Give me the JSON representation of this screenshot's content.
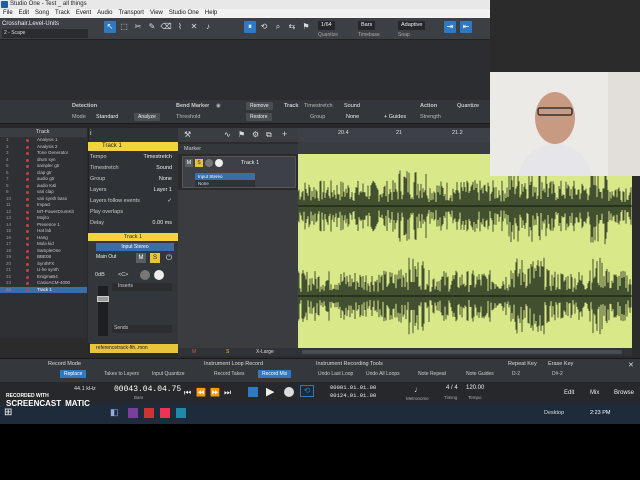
{
  "window": {
    "title": "Studio One - Test _ all things"
  },
  "menu": [
    "File",
    "Edit",
    "Song",
    "Track",
    "Event",
    "Audio",
    "Transport",
    "View",
    "Studio One",
    "Help"
  ],
  "toolbar": {
    "song_name": "Crosshair.Level-Units",
    "scene": "2 - Scape",
    "quantize_label": "Quantize",
    "quantize_value": "1/64",
    "timebase_label": "Timebase",
    "timebase_value": "Bars",
    "snap_label": "Snap",
    "snap_value": "Adaptive"
  },
  "detection": {
    "header": "Detection",
    "mode_label": "Mode",
    "mode_value": "Standard",
    "analyze": "Analyze",
    "bend_marker": "Bend Marker",
    "threshold": "Threshold",
    "remove": "Remove",
    "restore": "Restore",
    "track_header": "Track",
    "timestretch": "Timestretch",
    "sound": "Sound",
    "group": "Group",
    "none": "None",
    "guides": "+ Guides",
    "action_header": "Action",
    "quantize": "Quantize",
    "strength": "Strength"
  },
  "tracklist": {
    "header": "Track",
    "items": [
      {
        "num": "1",
        "name": "Analysis 1"
      },
      {
        "num": "2",
        "name": "Analysis 2"
      },
      {
        "num": "3",
        "name": "Tone Generator"
      },
      {
        "num": "4",
        "name": "drum syn"
      },
      {
        "num": "5",
        "name": "sampler gtr"
      },
      {
        "num": "6",
        "name": "clap gtr"
      },
      {
        "num": "7",
        "name": "audio gtr"
      },
      {
        "num": "8",
        "name": "audio K&l"
      },
      {
        "num": "9",
        "name": "vari clap"
      },
      {
        "num": "10",
        "name": "vari synth bass"
      },
      {
        "num": "11",
        "name": "Impact"
      },
      {
        "num": "12",
        "name": "MT-PowerDrumKit"
      },
      {
        "num": "13",
        "name": "Mojito"
      },
      {
        "num": "14",
        "name": "Presence 1"
      },
      {
        "num": "15",
        "name": "Hat lab"
      },
      {
        "num": "16",
        "name": "Hang"
      },
      {
        "num": "17",
        "name": "Mola kid"
      },
      {
        "num": "18",
        "name": "SampleOne"
      },
      {
        "num": "19",
        "name": "BBE08"
      },
      {
        "num": "20",
        "name": "SynthFX"
      },
      {
        "num": "21",
        "name": "U-he synth"
      },
      {
        "num": "22",
        "name": "EnigmaB4"
      },
      {
        "num": "23",
        "name": "CasioACM-4000"
      },
      {
        "num": "24",
        "name": "Track 1"
      }
    ],
    "selected_index": 23
  },
  "inspector": {
    "track_name": "Track 1",
    "tempo_label": "Tempo",
    "tempo_value": "Timestretch",
    "timestretch_label": "Timestretch",
    "timestretch_value": "Sound",
    "group_label": "Group",
    "group_value": "None",
    "layers_label": "Layers",
    "layers_value": "Layer 1",
    "layers_follow": "Layers follow events",
    "play_overlaps": "Play overlaps",
    "delay_label": "Delay",
    "delay_value": "0.00 ms",
    "channel_name": "Track 1",
    "input": "Input Stereo",
    "main_out": "Main Out",
    "gain": "0dB",
    "pan": "<C>",
    "inserts": "Inserts",
    "sends": "Sends",
    "reference_track": "referencetrack-fth..mon"
  },
  "arrange": {
    "marker_label": "Marker",
    "track_header_name": "Track 1",
    "input_label": "Input Stereo",
    "input_none": "None",
    "ruler_marks": [
      "20.4",
      "21",
      "21.2"
    ],
    "size_label": "X-Large",
    "mute_label": "M",
    "solo_label": "S"
  },
  "record_panel": {
    "record_mode": "Record Mode",
    "replace": "Replace",
    "takes_to_layers": "Takes to Layers",
    "input_quantize": "Input Quantize",
    "loop_record": "Instrument Loop Record",
    "record_takes": "Record Takes",
    "record_mix": "Record Mix",
    "tools_header": "Instrument Recording Tools",
    "undo_last_loop": "Undo Last Loop",
    "undo_all_loops": "Undo All Loops",
    "note_repeat": "Note Repeat",
    "note_guides": "Note Guides",
    "repeat_key": "Repeat Key",
    "repeat_key_value": "D-2",
    "erase_key": "Erase Key",
    "erase_key_value": "D#-2"
  },
  "transport": {
    "sample_rate": "44.1 kHz",
    "time": "00043.04.04.75",
    "time_unit": "Bars",
    "loop_start": "00001.01.01.00",
    "loop_end": "00124.01.01.00",
    "metronome": "Metronome",
    "timing_label": "Timing",
    "timing_value": "4 / 4",
    "tempo_label": "Tempo",
    "tempo_value": "120.00",
    "edit": "Edit",
    "mix": "Mix",
    "browse": "Browse"
  },
  "taskbar": {
    "desktop": "Desktop",
    "clock": "2:23 PM"
  },
  "watermark": {
    "line1": "RECORDED WITH",
    "line2": "SCREENCAST",
    "line3": "MATIC"
  },
  "colors": {
    "accent_blue": "#2f79c4",
    "track_yellow": "#f3d43a",
    "waveform_bg": "#d9e98a",
    "waveform": "#1d2a1a"
  }
}
